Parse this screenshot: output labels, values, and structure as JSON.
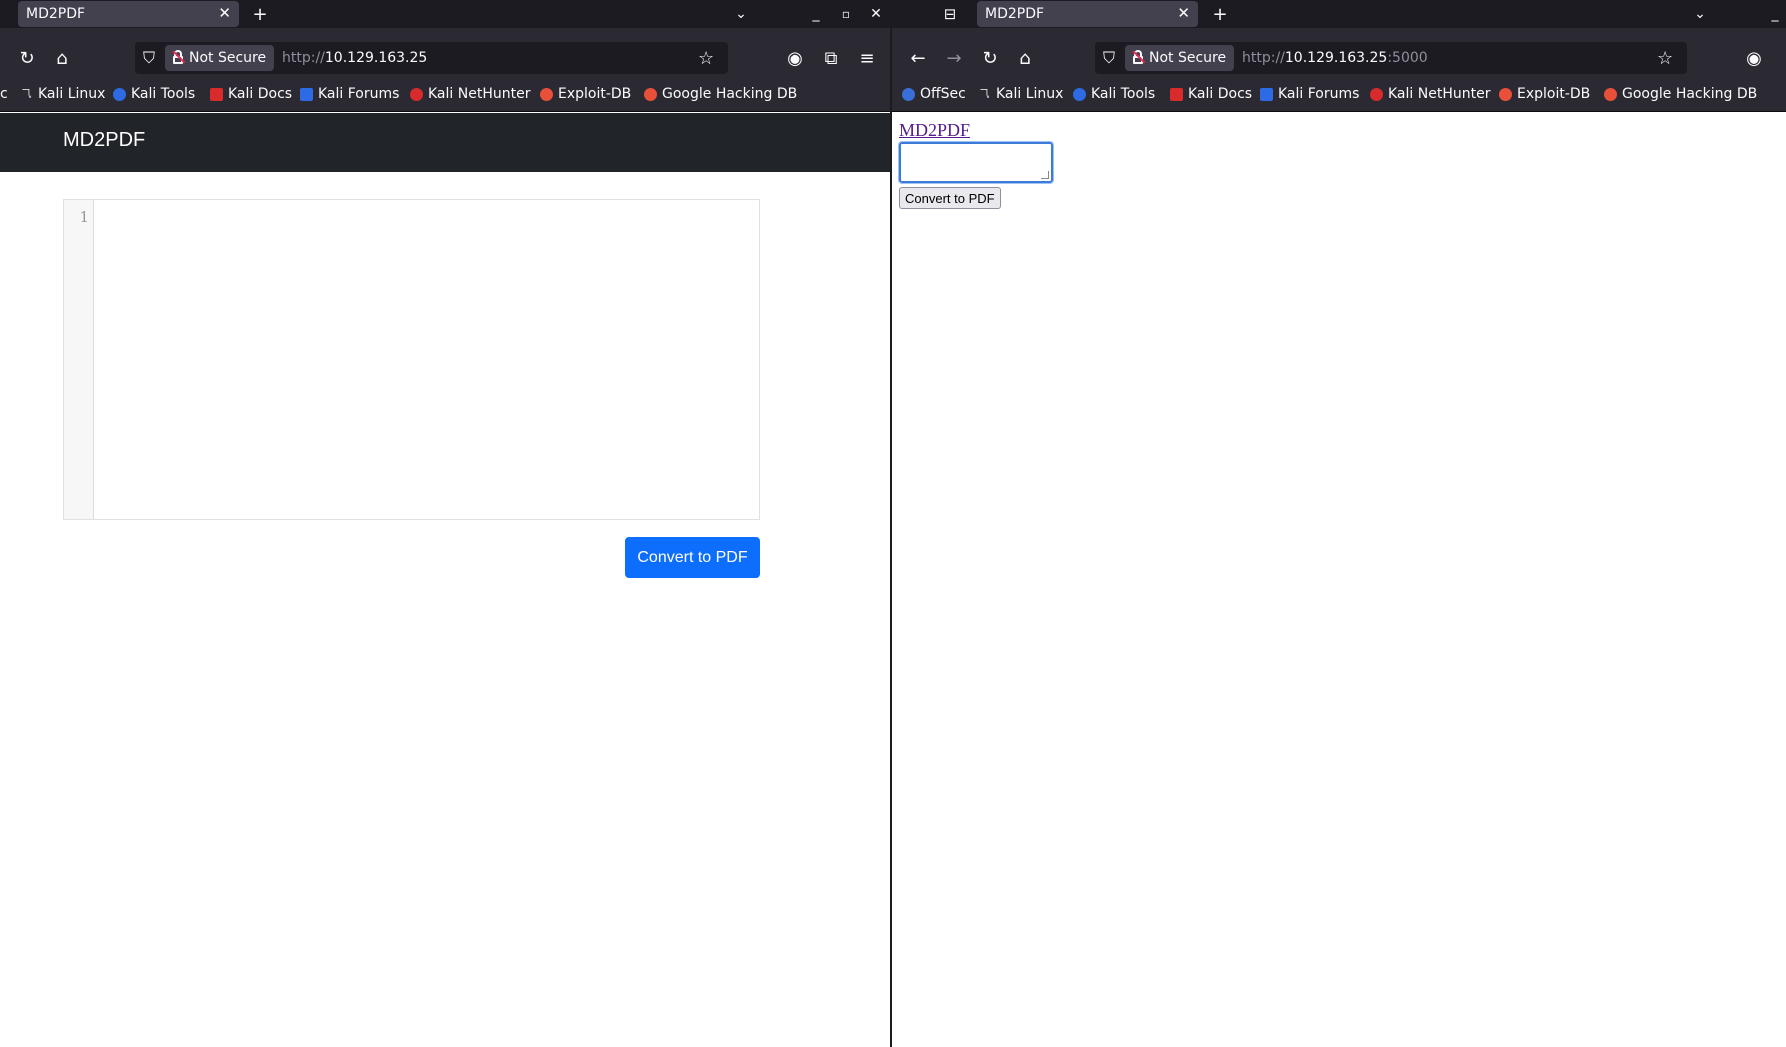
{
  "left_window": {
    "tab_title": "MD2PDF",
    "not_secure_label": "Not Secure",
    "url_prefix": "http://",
    "url_host": "10.129.163.25",
    "bookmarks": [
      "Kali Linux",
      "Kali Tools",
      "Kali Docs",
      "Kali Forums",
      "Kali NetHunter",
      "Exploit-DB",
      "Google Hacking DB"
    ],
    "bookmark_partial": "c",
    "app": {
      "brand": "MD2PDF",
      "line_number": "1",
      "convert_label": "Convert to PDF"
    }
  },
  "right_window": {
    "tab_title": "MD2PDF",
    "not_secure_label": "Not Secure",
    "url_prefix": "http://",
    "url_host": "10.129.163.25",
    "url_port": ":5000",
    "bookmarks": [
      "OffSec",
      "Kali Linux",
      "Kali Tools",
      "Kali Docs",
      "Kali Forums",
      "Kali NetHunter",
      "Exploit-DB",
      "Google Hacking DB"
    ],
    "app": {
      "link": "MD2PDF",
      "convert_label": "Convert to PDF"
    }
  },
  "colors": {
    "chrome_dark": "#1c1b22",
    "toolbar": "#2b2a33",
    "navbar": "#212529",
    "primary": "#0d6efd",
    "visited_link": "#551a8b"
  }
}
